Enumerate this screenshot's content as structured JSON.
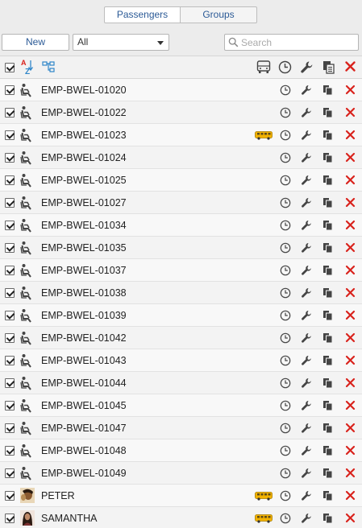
{
  "tabs": {
    "passengers": "Passengers",
    "groups": "Groups"
  },
  "toolbar": {
    "new_label": "New",
    "filter_value": "All",
    "search_placeholder": "Search"
  },
  "colors": {
    "link_blue": "#2b5a96",
    "delete_red": "#d9231d",
    "bus_yellow": "#f2b200",
    "tree_blue": "#2f86c9"
  },
  "header": {
    "select_all_icon": "checkbox-icon",
    "sort_icon": "sort-a-z-icon",
    "tree_icon": "hierarchy-icon",
    "bus_icon": "bus-icon",
    "clock_icon": "clock-icon",
    "wrench_icon": "wrench-icon",
    "copy_icon": "copy-icon",
    "delete_icon": "delete-icon"
  },
  "rows": [
    {
      "name": "EMP-BWEL-01020",
      "type": "seat",
      "bus": false
    },
    {
      "name": "EMP-BWEL-01022",
      "type": "seat",
      "bus": false
    },
    {
      "name": "EMP-BWEL-01023",
      "type": "seat",
      "bus": true
    },
    {
      "name": "EMP-BWEL-01024",
      "type": "seat",
      "bus": false
    },
    {
      "name": "EMP-BWEL-01025",
      "type": "seat",
      "bus": false
    },
    {
      "name": "EMP-BWEL-01027",
      "type": "seat",
      "bus": false
    },
    {
      "name": "EMP-BWEL-01034",
      "type": "seat",
      "bus": false
    },
    {
      "name": "EMP-BWEL-01035",
      "type": "seat",
      "bus": false
    },
    {
      "name": "EMP-BWEL-01037",
      "type": "seat",
      "bus": false
    },
    {
      "name": "EMP-BWEL-01038",
      "type": "seat",
      "bus": false
    },
    {
      "name": "EMP-BWEL-01039",
      "type": "seat",
      "bus": false
    },
    {
      "name": "EMP-BWEL-01042",
      "type": "seat",
      "bus": false
    },
    {
      "name": "EMP-BWEL-01043",
      "type": "seat",
      "bus": false
    },
    {
      "name": "EMP-BWEL-01044",
      "type": "seat",
      "bus": false
    },
    {
      "name": "EMP-BWEL-01045",
      "type": "seat",
      "bus": false
    },
    {
      "name": "EMP-BWEL-01047",
      "type": "seat",
      "bus": false
    },
    {
      "name": "EMP-BWEL-01048",
      "type": "seat",
      "bus": false
    },
    {
      "name": "EMP-BWEL-01049",
      "type": "seat",
      "bus": false
    },
    {
      "name": "PETER",
      "type": "photo-male",
      "bus": true
    },
    {
      "name": "SAMANTHA",
      "type": "photo-female",
      "bus": true
    }
  ]
}
